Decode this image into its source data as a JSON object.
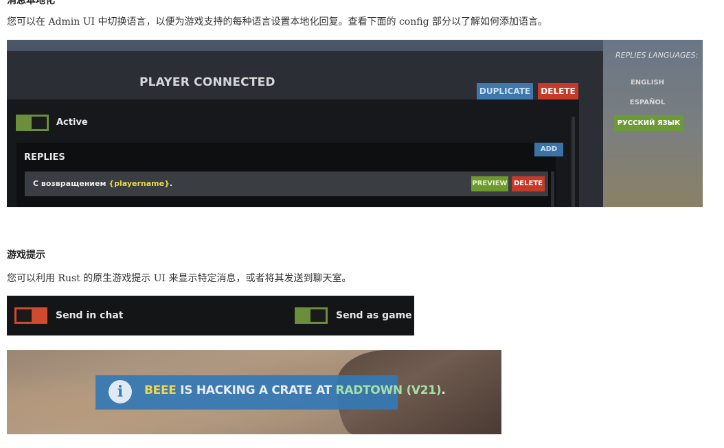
{
  "section1": {
    "heading": "消息本地化",
    "paragraph": "您可以在 Admin UI 中切换语言，以便为游戏支持的每种语言设置本地化回复。查看下面的 config 部分以了解如何添加语言。"
  },
  "admin_ui": {
    "title": "PLAYER CONNECTED",
    "duplicate_label": "DUPLICATE",
    "delete_label": "DELETE",
    "active_label": "Active",
    "replies_label": "REPLIES",
    "add_label": "ADD",
    "reply_text_prefix": "С возвращением ",
    "reply_variable": "{playername}",
    "reply_text_suffix": ".",
    "preview_label": "PREVIEW",
    "reply_delete_label": "DELETE",
    "languages_title": "REPLIES LANGUAGES:",
    "languages": [
      "ENGLISH",
      "ESPAÑOL",
      "РУССКИЙ ЯЗЫК"
    ],
    "active_language": "РУССКИЙ ЯЗЫК"
  },
  "section2": {
    "heading": "游戏提示",
    "paragraph": "您可以利用 Rust 的原生游戏提示 UI 来显示特定消息，或者将其发送到聊天室。"
  },
  "toggles": {
    "send_in_chat": "Send in chat",
    "send_as_game_tip": "Send as game tip"
  },
  "game_tip": {
    "player": "BEEE",
    "middle": " IS HACKING A CRATE AT ",
    "location": "RADTOWN (V21)",
    "end": "."
  },
  "colors": {
    "green_toggle": "#6b8e3c",
    "red_toggle": "#cf4a2e",
    "duplicate_blue": "#3f78ac",
    "delete_red": "#c63a2a",
    "tip_blue": "#3478b4"
  }
}
